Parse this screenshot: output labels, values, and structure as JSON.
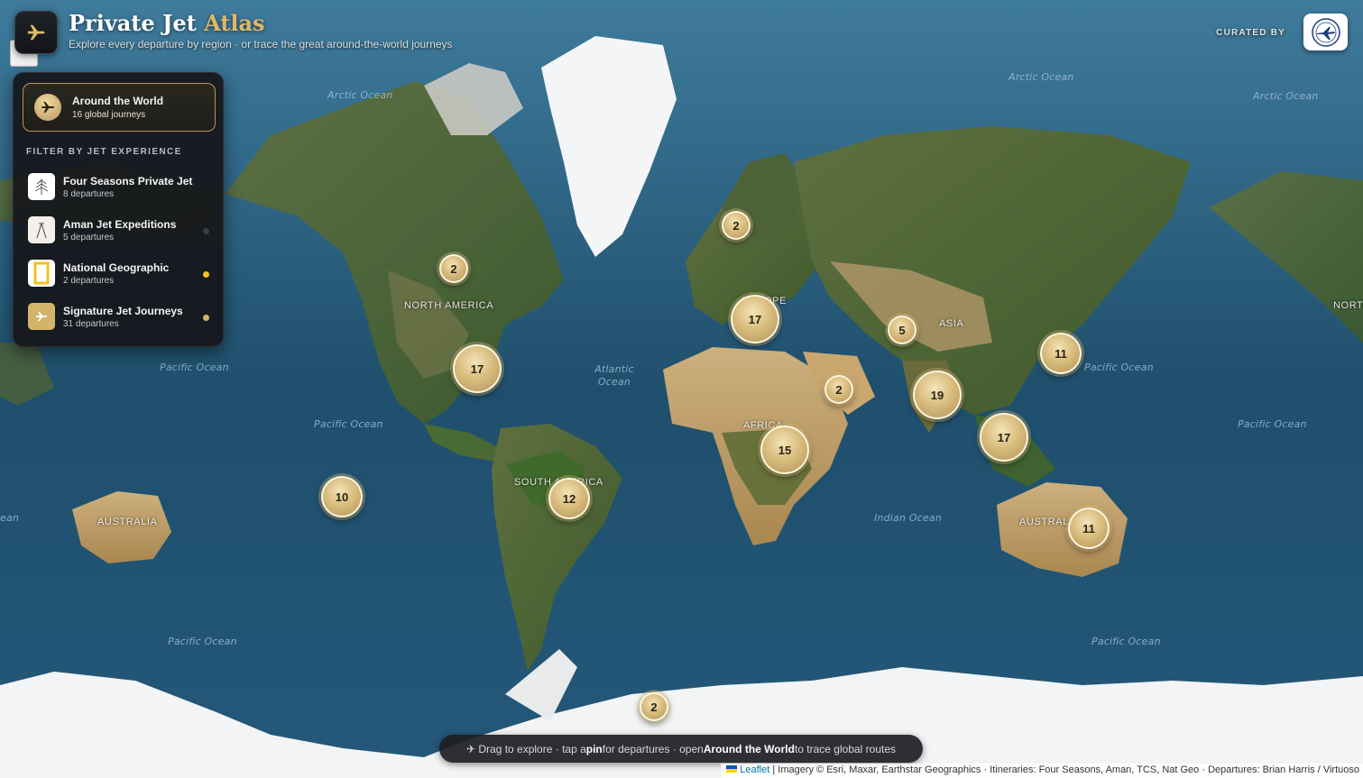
{
  "header": {
    "title_main": "Private Jet",
    "title_accent": "Atlas",
    "subtitle": "Explore every departure by region · or trace the great around-the-world journeys",
    "curated_label": "CURATED BY",
    "logo_icon": "airplane-icon",
    "curator_icon": "airplane-badge-icon"
  },
  "panel": {
    "around_world": {
      "title": "Around the World",
      "subtitle": "16 global journeys"
    },
    "filter_heading": "FILTER BY JET EXPERIENCE",
    "filters": [
      {
        "name": "Four Seasons Private Jet",
        "count": "8 departures",
        "icon": "pine-tree-icon",
        "dot": ""
      },
      {
        "name": "Aman Jet Expeditions",
        "count": "5 departures",
        "icon": "aman-logo-icon",
        "dot": "#3a3d42"
      },
      {
        "name": "National Geographic",
        "count": "2 departures",
        "icon": "natgeo-frame-icon",
        "dot": "#f2c31d"
      },
      {
        "name": "Signature Jet Journeys",
        "count": "31 departures",
        "icon": "airplane-icon",
        "dot": "#d4b36a"
      }
    ]
  },
  "map": {
    "ocean_labels": [
      "Arctic Ocean",
      "Arctic Ocean",
      "Arctic Ocean",
      "Pacific Ocean",
      "Atlantic Ocean",
      "Pacific Ocean",
      "Pacific Ocean",
      "Pacific Ocean",
      "Indian Ocean",
      "Pacific Ocean",
      "Pacific Ocean",
      "ean"
    ],
    "region_labels": [
      "NORTH AMERICA",
      "SOUTH AMERICA",
      "EUROPE",
      "AFRICA",
      "ASIA",
      "AUSTRALIA",
      "AUSTRALIA",
      "NORTH"
    ],
    "clusters": [
      2,
      2,
      17,
      17,
      5,
      11,
      2,
      19,
      17,
      15,
      10,
      12,
      11,
      2
    ]
  },
  "hint": {
    "prefix": "✈ Drag to explore · tap a ",
    "bold1": "pin",
    "mid": " for departures · open ",
    "bold2": "Around the World",
    "suffix": " to trace global routes"
  },
  "attribution": {
    "leaflet": "Leaflet",
    "rest": " | Imagery © Esri, Maxar, Earthstar Geographics · Itineraries: Four Seasons, Aman, TCS, Nat Geo · Departures: Brian Harris / Virtuoso"
  },
  "colors": {
    "accent": "#dcb86a",
    "panel_bg": "#16171c",
    "cluster_gold": "#d9bd7e"
  }
}
